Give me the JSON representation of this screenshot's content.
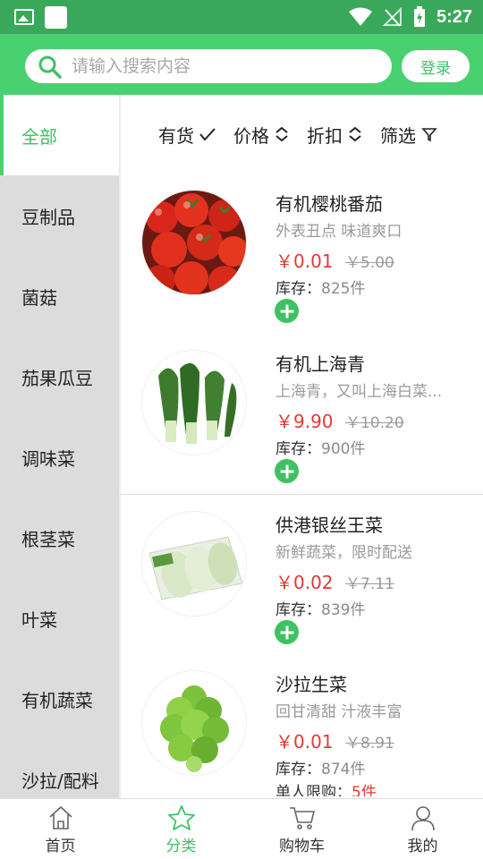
{
  "status_bar": {
    "time": "5:27"
  },
  "header": {
    "search_placeholder": "请输入搜索内容",
    "login_label": "登录"
  },
  "sidebar": {
    "items": [
      {
        "label": "全部",
        "active": true
      },
      {
        "label": "豆制品"
      },
      {
        "label": "菌菇"
      },
      {
        "label": "茄果瓜豆"
      },
      {
        "label": "调味菜"
      },
      {
        "label": "根茎菜"
      },
      {
        "label": "叶菜"
      },
      {
        "label": "有机蔬菜"
      },
      {
        "label": "沙拉/配料"
      }
    ]
  },
  "filters": [
    {
      "label": "有货",
      "icon": "check-icon"
    },
    {
      "label": "价格",
      "icon": "sort-icon"
    },
    {
      "label": "折扣",
      "icon": "sort-icon"
    },
    {
      "label": "筛选",
      "icon": "funnel-icon"
    }
  ],
  "stock_label": "库存：",
  "products": [
    {
      "name": "有机樱桃番茄",
      "desc": "外表丑点 味道爽口",
      "price": "￥0.01",
      "old_price": "￥5.00",
      "stock": "825件"
    },
    {
      "name": "有机上海青",
      "desc": "上海青，又叫上海白菜...",
      "price": "￥9.90",
      "old_price": "￥10.20",
      "stock": "900件"
    },
    {
      "name": "供港银丝王菜",
      "desc": "新鲜蔬菜，限时配送",
      "price": "￥0.02",
      "old_price": "￥7.11",
      "stock": "839件"
    },
    {
      "name": "沙拉生菜",
      "desc": "回甘清甜 汁液丰富",
      "price": "￥0.01",
      "old_price": "￥8.91",
      "stock": "874件",
      "limit_label": "单人限购：",
      "limit_value": "5件"
    }
  ],
  "tabbar": [
    {
      "label": "首页",
      "icon": "home-icon"
    },
    {
      "label": "分类",
      "icon": "star-icon",
      "active": true
    },
    {
      "label": "购物车",
      "icon": "cart-icon"
    },
    {
      "label": "我的",
      "icon": "user-icon"
    }
  ],
  "colors": {
    "brand_green": "#49d16f",
    "status_green": "#3aa85a",
    "price_red": "#e53935"
  }
}
